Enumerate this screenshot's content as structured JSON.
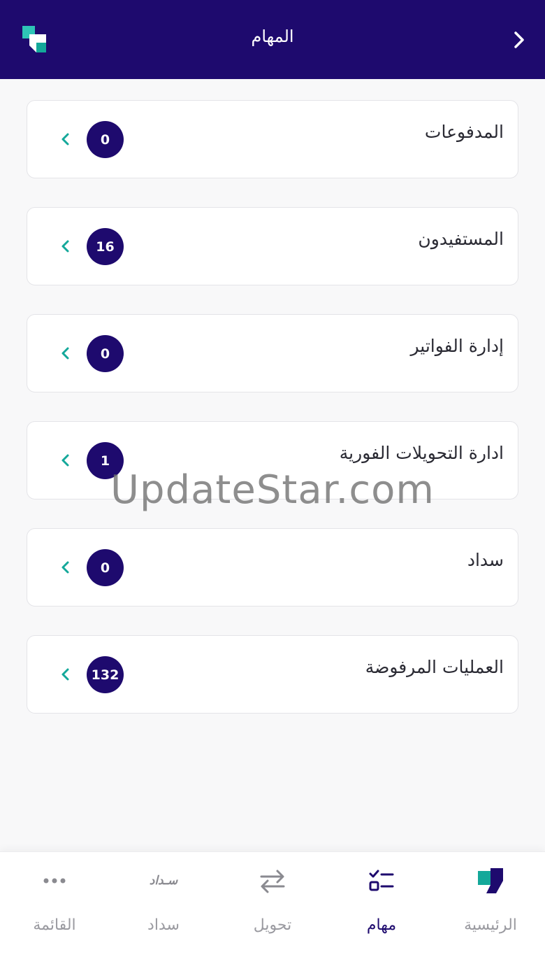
{
  "header": {
    "title": "المهام",
    "back_icon": "chevron-right-icon",
    "logo_icon": "app-logo-icon",
    "background": "#1e0a6e"
  },
  "tasks": [
    {
      "label": "المدفوعات",
      "count": "0"
    },
    {
      "label": "المستفيدون",
      "count": "16"
    },
    {
      "label": "إدارة الفواتير",
      "count": "0"
    },
    {
      "label": "ادارة التحويلات الفورية",
      "count": "1"
    },
    {
      "label": "سداد",
      "count": "0"
    },
    {
      "label": "العمليات المرفوضة",
      "count": "132"
    }
  ],
  "watermark": "UpdateStar.com",
  "tabbar": {
    "items": [
      {
        "label": "القائمة",
        "icon": "more-dots-icon"
      },
      {
        "label": "سداد",
        "icon": "sadad-logo-icon",
        "icon_text": "سـداد"
      },
      {
        "label": "تحويل",
        "icon": "transfer-arrows-icon"
      },
      {
        "label": "مهام",
        "icon": "tasks-checklist-icon",
        "active": true
      },
      {
        "label": "الرئيسية",
        "icon": "home-logo-icon"
      }
    ]
  },
  "colors": {
    "primary": "#1e0a6e",
    "accent": "#14a89a",
    "inactive": "#9a9aa0"
  }
}
